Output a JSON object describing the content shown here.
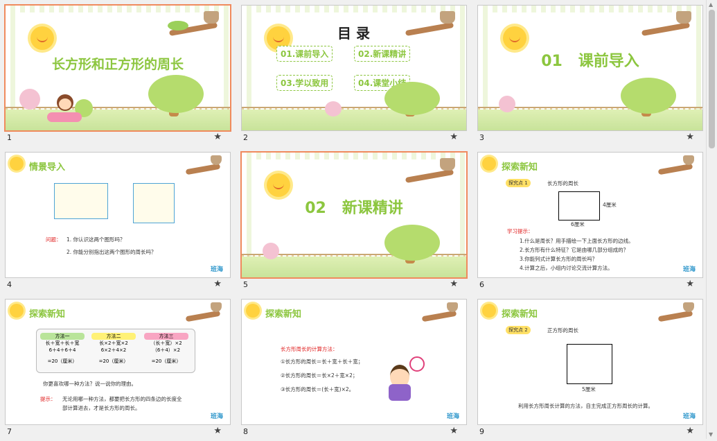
{
  "slides": [
    {
      "num": "1",
      "title": "长方形和正方形的周长"
    },
    {
      "num": "2",
      "title": "目 录",
      "items": [
        "01.课前导入",
        "02.新课精讲",
        "03.学以致用",
        "04.课堂小结"
      ]
    },
    {
      "num": "3",
      "title": "01   课前导入"
    },
    {
      "num": "4",
      "header": "情景导入",
      "q_label": "问题：",
      "q1": "1. 你认识这两个图形吗？",
      "q2": "2. 你能分别指出这两个图形的周长吗？"
    },
    {
      "num": "5",
      "title": "02   新课精讲"
    },
    {
      "num": "6",
      "header": "探索新知",
      "tag": "探究点 1",
      "tag_text": "长方形的周长",
      "dim_w": "6厘米",
      "dim_h": "4厘米",
      "hint_label": "学习提示：",
      "hints": [
        "1.什么是周长？用手描绘一下上面长方形的边线。",
        "2.长方形有什么特征？它是由哪几部分组成的？",
        "3.你能列式计算长方形的周长吗？",
        "4.计算之后，小组内讨论交流计算方法。"
      ]
    },
    {
      "num": "7",
      "header": "探索新知",
      "methods": [
        {
          "name": "方法一",
          "l1": "长＋宽＋长＋宽",
          "l2": "6＋4＋6＋4",
          "l3": "=20（厘米）",
          "color": "#b9e49a"
        },
        {
          "name": "方法二",
          "l1": "长×2＋宽×2",
          "l2": "6×2＋4×2",
          "l3": "=20（厘米）",
          "color": "#fff176"
        },
        {
          "name": "方法三",
          "l1": "（长＋宽）×2",
          "l2": "（6＋4）×2",
          "l3": "=20（厘米）",
          "color": "#f8a5c2"
        }
      ],
      "question": "你更喜欢哪一种方法？说一说你的理由。",
      "tip_label": "提示：",
      "tip_l1": "无论用哪一种方法，都要把长方形的四条边的长度全",
      "tip_l2": "部计算进去，才是长方形的周长。"
    },
    {
      "num": "8",
      "header": "探索新知",
      "calc_title": "长方形周长的计算方法：",
      "calc": [
        "①长方形的周长＝长＋宽＋长＋宽；",
        "②长方形的周长＝长×2＋宽×2；",
        "③长方形的周长＝(长＋宽)×2。"
      ]
    },
    {
      "num": "9",
      "header": "探索新知",
      "tag": "探究点 2",
      "tag_text": "正方形的周长",
      "dim": "5厘米",
      "footer": "利用长方形周长计算的方法，自主完成正方形周长的计算。"
    }
  ],
  "logo": "班海",
  "star_icon": "star-icon"
}
